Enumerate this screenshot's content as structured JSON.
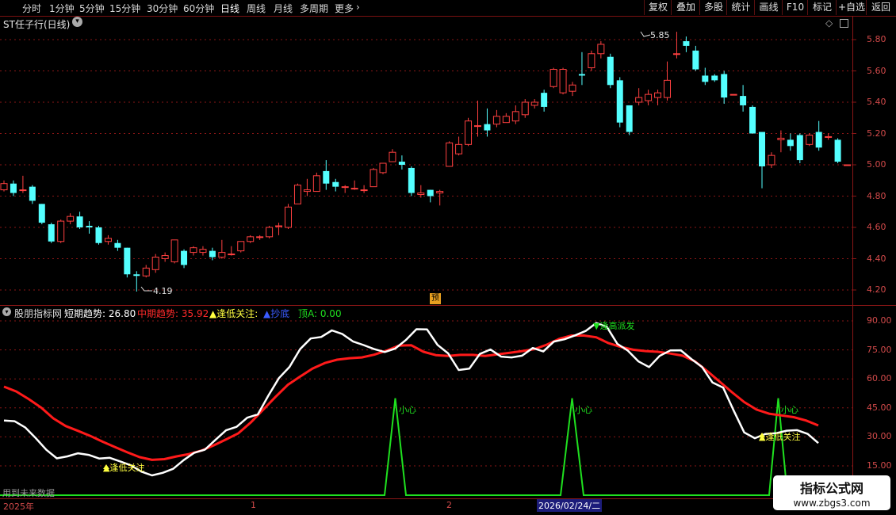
{
  "toolbar": {
    "periods": [
      "分时",
      "1分钟",
      "5分钟",
      "15分钟",
      "30分钟",
      "60分钟",
      "日线",
      "周线",
      "月线",
      "多周期",
      "更多"
    ],
    "active_period": "日线",
    "more_arrow": "›",
    "right_buttons": [
      "复权",
      "叠加",
      "多股",
      "统计",
      "画线",
      "F10",
      "标记",
      "+自选",
      "返回"
    ]
  },
  "main_chart": {
    "title": "ST任子行(日线)",
    "high_label": "5.85",
    "low_label": "4.19",
    "yu_badge": "预",
    "y_ticks": [
      "5.80",
      "5.60",
      "5.40",
      "5.20",
      "5.00",
      "4.80",
      "4.60",
      "4.40",
      "4.20"
    ],
    "y_values": [
      5.8,
      5.6,
      5.4,
      5.2,
      5.0,
      4.8,
      4.6,
      4.4,
      4.2
    ],
    "candles": [
      [
        4.84,
        4.88,
        4.83,
        4.9
      ],
      [
        4.88,
        4.82,
        4.8,
        4.9
      ],
      [
        4.84,
        4.84,
        4.82,
        4.93
      ],
      [
        4.86,
        4.77,
        4.75,
        4.87
      ],
      [
        4.75,
        4.63,
        4.62,
        4.75
      ],
      [
        4.62,
        4.51,
        4.5,
        4.63
      ],
      [
        4.51,
        4.64,
        4.5,
        4.65
      ],
      [
        4.64,
        4.67,
        4.62,
        4.69
      ],
      [
        4.67,
        4.6,
        4.59,
        4.7
      ],
      [
        4.61,
        4.6,
        4.56,
        4.64
      ],
      [
        4.6,
        4.5,
        4.49,
        4.61
      ],
      [
        4.51,
        4.53,
        4.49,
        4.55
      ],
      [
        4.5,
        4.47,
        4.45,
        4.52
      ],
      [
        4.47,
        4.3,
        4.28,
        4.47
      ],
      [
        4.3,
        4.29,
        4.19,
        4.32
      ],
      [
        4.29,
        4.34,
        4.28,
        4.36
      ],
      [
        4.33,
        4.41,
        4.31,
        4.43
      ],
      [
        4.4,
        4.42,
        4.38,
        4.44
      ],
      [
        4.38,
        4.52,
        4.37,
        4.52
      ],
      [
        4.45,
        4.36,
        4.34,
        4.46
      ],
      [
        4.44,
        4.47,
        4.42,
        4.48
      ],
      [
        4.44,
        4.46,
        4.42,
        4.48
      ],
      [
        4.45,
        4.41,
        4.39,
        4.47
      ],
      [
        4.41,
        4.44,
        4.4,
        4.52
      ],
      [
        4.43,
        4.43,
        4.42,
        4.48
      ],
      [
        4.45,
        4.51,
        4.44,
        4.51
      ],
      [
        4.51,
        4.54,
        4.5,
        4.55
      ],
      [
        4.54,
        4.54,
        4.52,
        4.55
      ],
      [
        4.54,
        4.6,
        4.53,
        4.61
      ],
      [
        4.61,
        4.61,
        4.55,
        4.63
      ],
      [
        4.6,
        4.73,
        4.59,
        4.75
      ],
      [
        4.75,
        4.87,
        4.75,
        4.88
      ],
      [
        4.83,
        4.84,
        4.8,
        4.91
      ],
      [
        4.83,
        4.93,
        4.83,
        4.95
      ],
      [
        4.96,
        4.88,
        4.84,
        5.03
      ],
      [
        4.89,
        4.86,
        4.83,
        4.91
      ],
      [
        4.86,
        4.86,
        4.82,
        4.87
      ],
      [
        4.85,
        4.85,
        4.84,
        4.9
      ],
      [
        4.84,
        4.84,
        4.82,
        4.87
      ],
      [
        4.86,
        4.97,
        4.86,
        4.98
      ],
      [
        4.95,
        5.01,
        4.94,
        5.01
      ],
      [
        5.02,
        5.08,
        5.02,
        5.1
      ],
      [
        5.02,
        5.0,
        4.97,
        5.06
      ],
      [
        4.98,
        4.82,
        4.8,
        4.99
      ],
      [
        4.81,
        4.82,
        4.79,
        4.87
      ],
      [
        4.84,
        4.8,
        4.76,
        4.84
      ],
      [
        4.82,
        4.83,
        4.74,
        4.84
      ],
      [
        4.99,
        5.14,
        4.99,
        5.15
      ],
      [
        5.07,
        5.13,
        5.06,
        5.18
      ],
      [
        5.13,
        5.28,
        5.12,
        5.3
      ],
      [
        5.25,
        5.25,
        5.18,
        5.41
      ],
      [
        5.26,
        5.22,
        5.18,
        5.36
      ],
      [
        5.26,
        5.31,
        5.24,
        5.35
      ],
      [
        5.27,
        5.31,
        5.27,
        5.33
      ],
      [
        5.28,
        5.34,
        5.26,
        5.38
      ],
      [
        5.32,
        5.4,
        5.3,
        5.42
      ],
      [
        5.38,
        5.4,
        5.36,
        5.42
      ],
      [
        5.46,
        5.37,
        5.34,
        5.48
      ],
      [
        5.5,
        5.61,
        5.49,
        5.62
      ],
      [
        5.46,
        5.61,
        5.45,
        5.62
      ],
      [
        5.47,
        5.51,
        5.44,
        5.53
      ],
      [
        5.58,
        5.57,
        5.51,
        5.72
      ],
      [
        5.62,
        5.71,
        5.6,
        5.73
      ],
      [
        5.71,
        5.77,
        5.68,
        5.79
      ],
      [
        5.69,
        5.51,
        5.49,
        5.71
      ],
      [
        5.54,
        5.27,
        5.24,
        5.56
      ],
      [
        5.38,
        5.21,
        5.19,
        5.38
      ],
      [
        5.4,
        5.43,
        5.38,
        5.49
      ],
      [
        5.41,
        5.45,
        5.38,
        5.48
      ],
      [
        5.43,
        5.46,
        5.38,
        5.48
      ],
      [
        5.43,
        5.54,
        5.41,
        5.66
      ],
      [
        5.71,
        5.71,
        5.68,
        5.85
      ],
      [
        5.79,
        5.76,
        5.72,
        5.82
      ],
      [
        5.73,
        5.61,
        5.6,
        5.76
      ],
      [
        5.57,
        5.53,
        5.51,
        5.62
      ],
      [
        5.57,
        5.54,
        5.53,
        5.58
      ],
      [
        5.58,
        5.43,
        5.39,
        5.6
      ],
      [
        5.45,
        5.45,
        5.45,
        5.45
      ],
      [
        5.44,
        5.38,
        5.34,
        5.51
      ],
      [
        5.37,
        5.2,
        5.2,
        5.38
      ],
      [
        5.21,
        4.99,
        4.85,
        5.2
      ],
      [
        5.0,
        5.06,
        4.98,
        5.08
      ],
      [
        5.16,
        5.17,
        5.08,
        5.22
      ],
      [
        5.16,
        5.12,
        5.09,
        5.2
      ],
      [
        5.19,
        5.03,
        5.01,
        5.2
      ],
      [
        5.13,
        5.19,
        5.12,
        5.2
      ],
      [
        5.21,
        5.11,
        5.09,
        5.28
      ],
      [
        5.18,
        5.18,
        5.16,
        5.2
      ],
      [
        5.16,
        5.02,
        5.01,
        5.17
      ],
      [
        5.0,
        5.0,
        5.0,
        5.0
      ]
    ]
  },
  "indicator": {
    "name": "股朋指标网",
    "short_label": "短期趋势: 26.80",
    "mid_label": "中期趋势: 35.92",
    "low_label": "▲逢低关注:",
    "bottom_label": "▲抄底",
    "top_label": "顶A: 0.00",
    "y_ticks": [
      "90.00",
      "75.00",
      "60.00",
      "45.00",
      "30.00",
      "15.00"
    ],
    "y_values": [
      90,
      75,
      60,
      45,
      30,
      15
    ],
    "short_trend": [
      38.5,
      38.1,
      34.9,
      29.4,
      23.3,
      18.9,
      19.9,
      21.5,
      20.7,
      18.8,
      19.2,
      17.3,
      15.3,
      12.0,
      10.1,
      11.4,
      13.5,
      18.0,
      21.8,
      23.4,
      28.5,
      33.4,
      35.2,
      39.9,
      41.6,
      51.3,
      60.4,
      66.2,
      75.4,
      80.9,
      81.7,
      85.1,
      83.2,
      79.4,
      77.5,
      75.4,
      73.9,
      75.7,
      80.1,
      85.7,
      85.6,
      77.6,
      73.2,
      64.6,
      65.3,
      72.9,
      75.2,
      71.5,
      71.1,
      72.0,
      76.0,
      74.2,
      79.3,
      80.5,
      82.5,
      84.8,
      88.9,
      87.0,
      78.1,
      74.6,
      69.0,
      66.1,
      71.9,
      74.7,
      74.8,
      70.3,
      66.2,
      58.1,
      55.5,
      43.6,
      32.3,
      29.3,
      31.5,
      31.9,
      33.2,
      33.5,
      31.5,
      26.8
    ],
    "mid_trend": [
      56.0,
      53.5,
      49.6,
      45.2,
      39.6,
      35.6,
      33.1,
      30.5,
      27.5,
      24.7,
      22.0,
      19.5,
      18.1,
      18.5,
      19.9,
      21.1,
      22.9,
      25.6,
      28.7,
      31.9,
      37.4,
      44.0,
      50.6,
      56.9,
      61.2,
      65.3,
      68.2,
      69.9,
      70.7,
      71.1,
      72.5,
      74.6,
      77.2,
      77.4,
      74.0,
      72.3,
      71.9,
      72.4,
      72.4,
      71.9,
      72.7,
      73.5,
      74.4,
      75.4,
      77.7,
      80.7,
      82.4,
      82.4,
      81.5,
      78.5,
      76.5,
      75.1,
      74.4,
      74.0,
      73.1,
      72.0,
      69.1,
      64.0,
      58.6,
      53.1,
      48.0,
      44.1,
      42.0,
      41.1,
      40.2,
      38.5,
      35.9
    ],
    "top_signal": [
      0,
      0,
      0,
      0,
      0,
      0,
      0,
      0,
      0,
      0,
      0,
      0,
      0,
      0,
      0,
      0,
      0,
      0,
      0,
      0,
      0,
      0,
      0,
      0,
      0,
      0,
      0,
      0,
      0,
      0,
      0,
      0,
      0,
      0,
      0,
      0,
      0,
      0,
      0,
      0,
      0,
      0,
      0,
      0,
      0,
      0,
      0,
      0,
      0,
      0,
      0,
      0,
      0,
      0,
      0,
      0,
      0,
      0,
      0,
      0,
      0,
      0,
      0,
      0,
      0,
      0,
      0,
      0,
      0,
      0,
      0,
      0,
      0,
      0,
      0,
      0,
      0,
      0,
      0,
      0
    ],
    "signals": {
      "careful": "小心",
      "low_watch": "▲逢低关注",
      "high_sell": "▼逢高派发"
    },
    "future_data_note": "用到未来数据"
  },
  "date_axis": {
    "start": "2025年",
    "m1": "1",
    "m2": "2",
    "cursor": "2026/02/24/二"
  },
  "logo": {
    "title": "指标公式网",
    "url": "www.zbgs3.com"
  },
  "colors": {
    "up": "#ff4040",
    "down": "#54ffff",
    "short_trend": "#ffffff",
    "mid_trend": "#ff1a1a",
    "top_signal": "#1fe01f",
    "grid": "#8a1616",
    "axis_text": "#d24a4a"
  }
}
